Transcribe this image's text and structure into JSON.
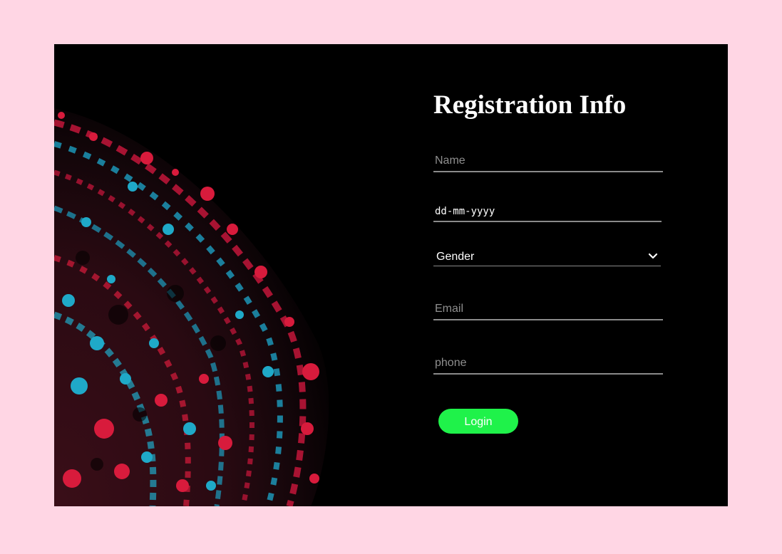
{
  "form": {
    "title": "Registration Info",
    "name_placeholder": "Name",
    "date_placeholder": "dd-mm-yyyy",
    "gender_selected": "Gender",
    "email_placeholder": "Email",
    "phone_placeholder": "phone",
    "login_label": "Login"
  },
  "colors": {
    "page_background": "#ffd6e4",
    "card_background": "#000000",
    "button": "#1ff24a",
    "art_red": "#d81b3c",
    "art_cyan": "#1fa9c8"
  },
  "icons": {
    "select": "chevron-down-icon"
  }
}
